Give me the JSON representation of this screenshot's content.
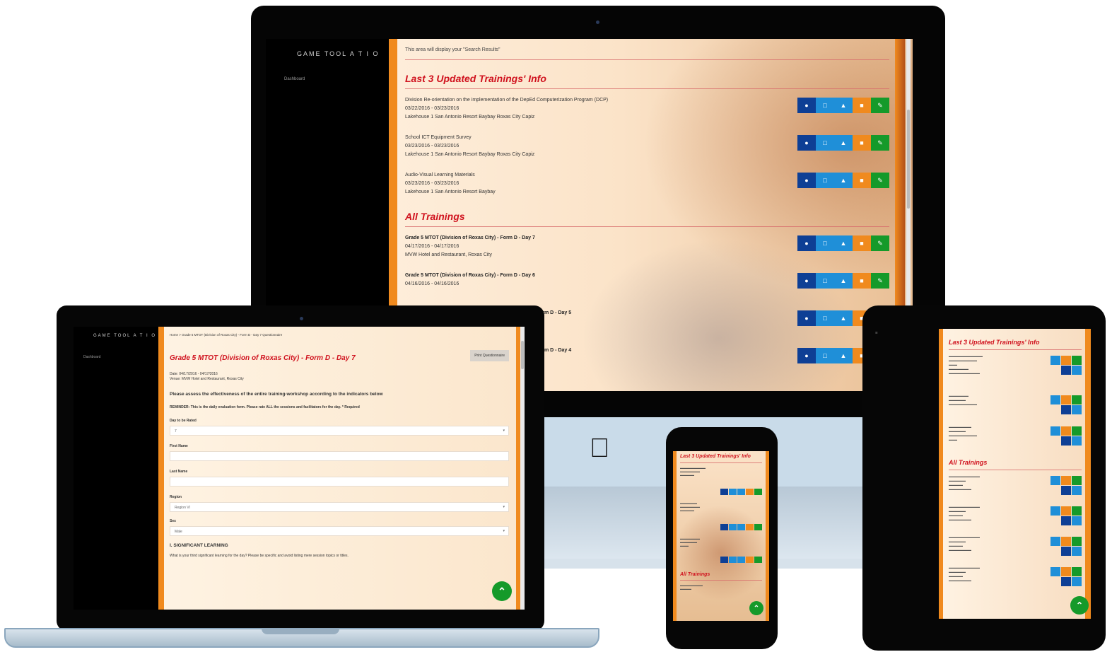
{
  "desktop": {
    "brand": "GAME TOOL A T I O",
    "nav_dashboard": "Dashboard",
    "search_message": "This area will display your \"Search Results\"",
    "recent_heading": "Last 3 Updated Trainings' Info",
    "recent": [
      {
        "title": "Division Re-orientation on the implementation of the DepEd Computerization Program (DCP)",
        "dates": "03/22/2016 - 03/23/2016",
        "venue": "Lakehouse 1 San Antonio Resort Baybay Roxas City Capiz"
      },
      {
        "title": "School ICT Equipment Survey",
        "dates": "03/23/2016 - 03/23/2016",
        "venue": "Lakehouse 1 San Antonio Resort Baybay Roxas City Capiz"
      },
      {
        "title": "Audio-Visual Learning Materials",
        "dates": "03/23/2016 - 03/23/2016",
        "venue": "Lakehouse 1 San Antonio Resort Baybay"
      }
    ],
    "all_heading": "All Trainings",
    "all": [
      {
        "title": "Grade 5 MTOT (Division of Roxas City) - Form D - Day 7",
        "dates": "04/17/2016 - 04/17/2016",
        "venue": "MVW Hotel and Restaurant, Roxas City"
      },
      {
        "title": "Grade 5 MTOT (Division of Roxas City) - Form D - Day 6",
        "dates": "04/16/2016 - 04/16/2016",
        "venue": ""
      },
      {
        "title": "orm D - Day 5",
        "dates": "",
        "venue": ""
      },
      {
        "title": "orm D - Day 4",
        "dates": "",
        "venue": ""
      }
    ]
  },
  "laptop": {
    "brand": "GAME TOOL A T I O",
    "nav_dashboard": "Dashboard",
    "breadcrumb": "Home > Grade 5 MTOT (Division of Roxas City) - Form D - Day 7 Questionnaire",
    "print_label": "Print Questionnaire",
    "title": "Grade 5 MTOT (Division of Roxas City) - Form D - Day 7",
    "date_line": "Date: 04/17/2016 - 04/17/2016",
    "venue_line": "Venue: MVW Hotel and Restaurant, Roxas City",
    "instruction": "Please assess the effectiveness of the entire training-workshop according to the indicators below",
    "reminder": "REMINDER: This is the daily evaluation form. Please rate ALL the sessions and facilitators for the day. * Required",
    "fields": [
      {
        "label": "Day to be Rated",
        "value": "7",
        "type": "select"
      },
      {
        "label": "First Name",
        "value": "",
        "type": "text"
      },
      {
        "label": "Last Name",
        "value": "",
        "type": "text"
      },
      {
        "label": "Region",
        "value": "Region VI",
        "type": "select"
      },
      {
        "label": "Sex",
        "value": "Male",
        "type": "select"
      }
    ],
    "section": "I. SIGNIFICANT LEARNING",
    "question": "What is your third significant learning for the day? Please be specific and avoid listing mere session topics or titles."
  },
  "tablet": {
    "recent_heading": "Last 3 Updated Trainings' Info",
    "all_heading": "All Trainings"
  },
  "phone": {
    "recent_heading": "Last 3 Updated Trainings' Info",
    "all_heading": "All Trainings"
  },
  "colors": {
    "accent_red": "#d0121e",
    "orange": "#f08a1e",
    "green": "#159a2a",
    "blue": "#1f8fd8",
    "navy": "#0e3f95"
  }
}
